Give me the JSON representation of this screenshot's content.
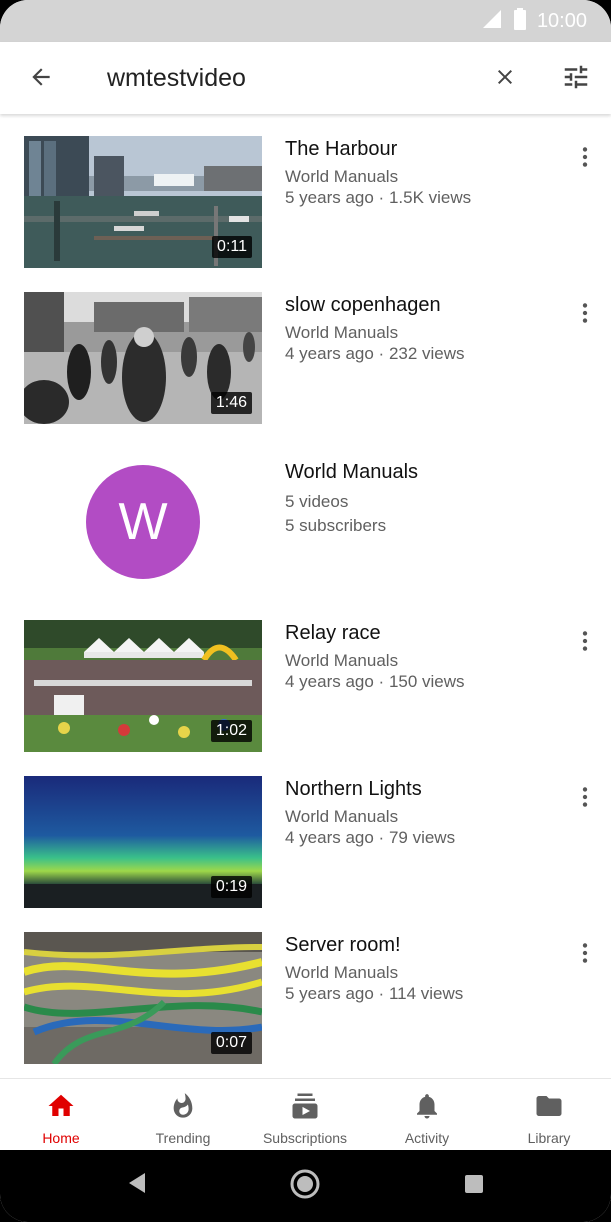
{
  "status_bar": {
    "time": "10:00"
  },
  "app_bar": {
    "search_query": "wmtestvideo",
    "back_icon": "arrow-left-icon",
    "clear_icon": "close-icon",
    "filter_icon": "tune-icon"
  },
  "results": {
    "videos": [
      {
        "title": "The Harbour",
        "channel": "World Manuals",
        "meta": "5 years ago · 1.5K views",
        "duration": "0:11"
      },
      {
        "title": "slow copenhagen",
        "channel": "World Manuals",
        "meta": "4 years ago · 232 views",
        "duration": "1:46"
      },
      {
        "title": "Relay race",
        "channel": "World Manuals",
        "meta": "4 years ago · 150 views",
        "duration": "1:02"
      },
      {
        "title": "Northern Lights",
        "channel": "World Manuals",
        "meta": "4 years ago · 79 views",
        "duration": "0:19"
      },
      {
        "title": "Server room!",
        "channel": "World Manuals",
        "meta": "5 years ago · 114 views",
        "duration": "0:07"
      }
    ],
    "channel": {
      "name": "World Manuals",
      "avatar_letter": "W",
      "videos": "5 videos",
      "subscribers": "5 subscribers",
      "avatar_color": "#b24cc4"
    }
  },
  "bottom_nav": {
    "items": [
      {
        "label": "Home",
        "icon": "home-icon",
        "active": true
      },
      {
        "label": "Trending",
        "icon": "flame-icon",
        "active": false
      },
      {
        "label": "Subscriptions",
        "icon": "subscriptions-icon",
        "active": false
      },
      {
        "label": "Activity",
        "icon": "bell-icon",
        "active": false
      },
      {
        "label": "Library",
        "icon": "folder-icon",
        "active": false
      }
    ],
    "active_color": "#e00000"
  },
  "system_nav": {
    "back": "back-triangle-icon",
    "home": "home-circle-icon",
    "recents": "recents-square-icon"
  }
}
